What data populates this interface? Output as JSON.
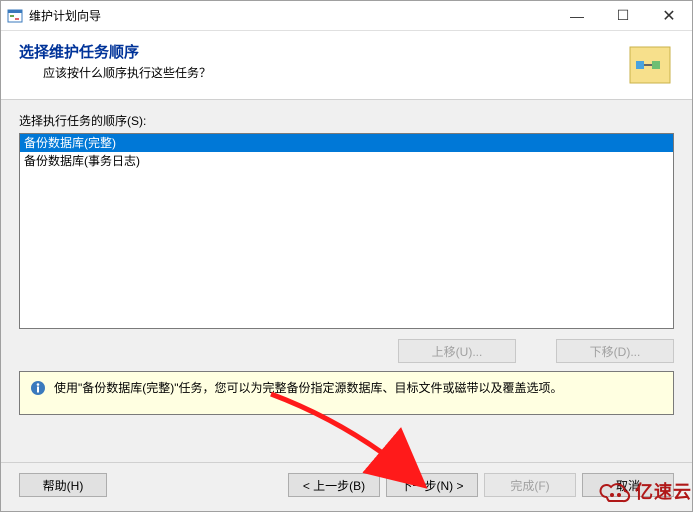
{
  "titlebar": {
    "title": "维护计划向导"
  },
  "header": {
    "title": "选择维护任务顺序",
    "subtitle": "应该按什么顺序执行这些任务？"
  },
  "content": {
    "list_label": "选择执行任务的顺序(S):",
    "items": [
      {
        "label": "备份数据库(完整)",
        "selected": true
      },
      {
        "label": "备份数据库(事务日志)",
        "selected": false
      }
    ],
    "move_up": "上移(U)...",
    "move_down": "下移(D)...",
    "info_text": "使用\"备份数据库(完整)\"任务，您可以为完整备份指定源数据库、目标文件或磁带以及覆盖选项。"
  },
  "footer": {
    "help": "帮助(H)",
    "back": "< 上一步(B)",
    "next": "下一步(N) >",
    "finish": "完成(F)",
    "cancel": "取消"
  },
  "watermark": {
    "text": "亿速云"
  }
}
